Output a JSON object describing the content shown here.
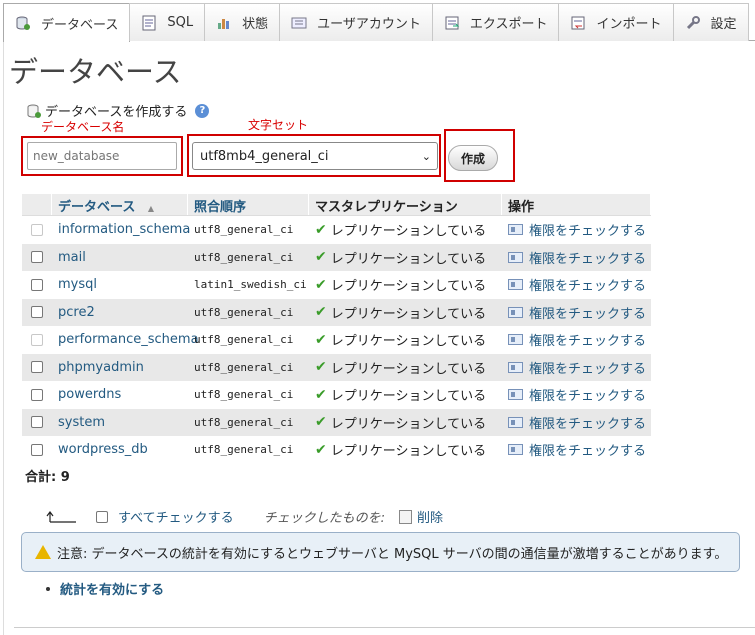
{
  "tabs": [
    {
      "label": "データベース",
      "icon": "database-icon",
      "active": true
    },
    {
      "label": "SQL",
      "icon": "sql-icon"
    },
    {
      "label": "状態",
      "icon": "status-icon"
    },
    {
      "label": "ユーザアカウント",
      "icon": "users-icon"
    },
    {
      "label": "エクスポート",
      "icon": "export-icon"
    },
    {
      "label": "インポート",
      "icon": "import-icon"
    },
    {
      "label": "設定",
      "icon": "wrench-icon"
    }
  ],
  "page_title": "データベース",
  "create": {
    "heading": "データベースを作成する",
    "annotation_name": "データベース名",
    "annotation_charset": "文字セット",
    "db_name_placeholder": "new_database",
    "collation_value": "utf8mb4_general_ci",
    "create_button": "作成"
  },
  "table": {
    "headers": {
      "database": "データベース",
      "collation": "照合順序",
      "replication": "マスタレプリケーション",
      "action": "操作"
    },
    "rows": [
      {
        "name": "information_schema",
        "collation": "utf8_general_ci",
        "replication": "レプリケーションしている",
        "action": "権限をチェックする",
        "disabled": true
      },
      {
        "name": "mail",
        "collation": "utf8_general_ci",
        "replication": "レプリケーションしている",
        "action": "権限をチェックする"
      },
      {
        "name": "mysql",
        "collation": "latin1_swedish_ci",
        "replication": "レプリケーションしている",
        "action": "権限をチェックする"
      },
      {
        "name": "pcre2",
        "collation": "utf8_general_ci",
        "replication": "レプリケーションしている",
        "action": "権限をチェックする"
      },
      {
        "name": "performance_schema",
        "collation": "utf8_general_ci",
        "replication": "レプリケーションしている",
        "action": "権限をチェックする",
        "disabled": true
      },
      {
        "name": "phpmyadmin",
        "collation": "utf8_general_ci",
        "replication": "レプリケーションしている",
        "action": "権限をチェックする"
      },
      {
        "name": "powerdns",
        "collation": "utf8_general_ci",
        "replication": "レプリケーションしている",
        "action": "権限をチェックする"
      },
      {
        "name": "system",
        "collation": "utf8_general_ci",
        "replication": "レプリケーションしている",
        "action": "権限をチェックする"
      },
      {
        "name": "wordpress_db",
        "collation": "utf8_general_ci",
        "replication": "レプリケーションしている",
        "action": "権限をチェックする"
      }
    ],
    "total": "合計: 9"
  },
  "bulk": {
    "check_all": "すべてチェックする",
    "with_selected": "チェックしたものを:",
    "delete": "削除"
  },
  "notice": "注意: データベースの統計を有効にするとウェブサーバと MySQL サーバの間の通信量が激増することがあります。",
  "enable_stats": "統計を有効にする",
  "colors": {
    "link": "#235a81",
    "annotation": "#d80000"
  }
}
